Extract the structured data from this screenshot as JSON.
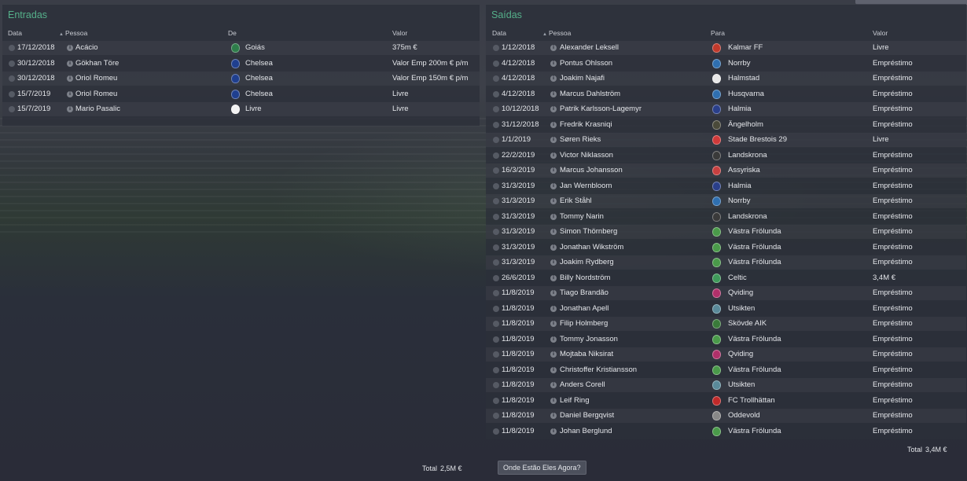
{
  "incoming": {
    "title": "Entradas",
    "headers": {
      "date": "Data",
      "person": "Pessoa",
      "from": "De",
      "value": "Valor"
    },
    "rows": [
      {
        "date": "17/12/2018",
        "person": "Acácio",
        "club": "Goiás",
        "value": "375m €",
        "badge_color": "#2e7d4a"
      },
      {
        "date": "30/12/2018",
        "person": "Gökhan Töre",
        "club": "Chelsea",
        "value": "Valor Emp 200m € p/m",
        "badge_color": "#1f3f8f"
      },
      {
        "date": "30/12/2018",
        "person": "Oriol Romeu",
        "club": "Chelsea",
        "value": "Valor Emp 150m € p/m",
        "badge_color": "#1f3f8f"
      },
      {
        "date": "15/7/2019",
        "person": "Oriol Romeu",
        "club": "Chelsea",
        "value": "Livre",
        "badge_color": "#1f3f8f"
      },
      {
        "date": "15/7/2019",
        "person": "Mario Pasalic",
        "club": "Livre",
        "value": "Livre",
        "badge_color": "#f2f2f2"
      }
    ],
    "total_label": "Total",
    "total_value": "2,5M €"
  },
  "outgoing": {
    "title": "Saídas",
    "headers": {
      "date": "Data",
      "person": "Pessoa",
      "to": "Para",
      "value": "Valor"
    },
    "rows": [
      {
        "date": "1/12/2018",
        "person": "Alexander Leksell",
        "club": "Kalmar FF",
        "value": "Livre",
        "badge_color": "#c0392b"
      },
      {
        "date": "4/12/2018",
        "person": "Pontus Ohlsson",
        "club": "Norrby",
        "value": "Empréstimo",
        "badge_color": "#2f6fb0"
      },
      {
        "date": "4/12/2018",
        "person": "Joakim Najafi",
        "club": "Halmstad",
        "value": "Empréstimo",
        "badge_color": "#e8e8e8"
      },
      {
        "date": "4/12/2018",
        "person": "Marcus Dahlström",
        "club": "Husqvarna",
        "value": "Empréstimo",
        "badge_color": "#2f6fb0"
      },
      {
        "date": "10/12/2018",
        "person": "Patrik Karlsson-Lagemyr",
        "club": "Halmia",
        "value": "Empréstimo",
        "badge_color": "#2a3f8a"
      },
      {
        "date": "31/12/2018",
        "person": "Fredrik Krasniqi",
        "club": "Ängelholm",
        "value": "Empréstimo",
        "badge_color": "#4a4a3a"
      },
      {
        "date": "1/1/2019",
        "person": "Søren Rieks",
        "club": "Stade Brestois 29",
        "value": "Livre",
        "badge_color": "#d03a3a"
      },
      {
        "date": "22/2/2019",
        "person": "Victor Niklasson",
        "club": "Landskrona",
        "value": "Empréstimo",
        "badge_color": "#3a3a3a"
      },
      {
        "date": "16/3/2019",
        "person": "Marcus Johansson",
        "club": "Assyriska",
        "value": "Empréstimo",
        "badge_color": "#c74040"
      },
      {
        "date": "31/3/2019",
        "person": "Jan Wernbloom",
        "club": "Halmia",
        "value": "Empréstimo",
        "badge_color": "#2a3f8a"
      },
      {
        "date": "31/3/2019",
        "person": "Erik Ståhl",
        "club": "Norrby",
        "value": "Empréstimo",
        "badge_color": "#2f6fb0"
      },
      {
        "date": "31/3/2019",
        "person": "Tommy Narin",
        "club": "Landskrona",
        "value": "Empréstimo",
        "badge_color": "#3a3a3a"
      },
      {
        "date": "31/3/2019",
        "person": "Simon Thörnberg",
        "club": "Västra Frölunda",
        "value": "Empréstimo",
        "badge_color": "#4a9a4a"
      },
      {
        "date": "31/3/2019",
        "person": "Jonathan Wikström",
        "club": "Västra Frölunda",
        "value": "Empréstimo",
        "badge_color": "#4a9a4a"
      },
      {
        "date": "31/3/2019",
        "person": "Joakim Rydberg",
        "club": "Västra Frölunda",
        "value": "Empréstimo",
        "badge_color": "#4a9a4a"
      },
      {
        "date": "26/6/2019",
        "person": "Billy Nordström",
        "club": "Celtic",
        "value": "3,4M €",
        "badge_color": "#3f9a5a"
      },
      {
        "date": "11/8/2019",
        "person": "Tiago Brandão",
        "club": "Qviding",
        "value": "Empréstimo",
        "badge_color": "#b0306a"
      },
      {
        "date": "11/8/2019",
        "person": "Jonathan Apell",
        "club": "Utsikten",
        "value": "Empréstimo",
        "badge_color": "#5a8a9a"
      },
      {
        "date": "11/8/2019",
        "person": "Filip Holmberg",
        "club": "Skövde AIK",
        "value": "Empréstimo",
        "badge_color": "#3a7a3a"
      },
      {
        "date": "11/8/2019",
        "person": "Tommy Jonasson",
        "club": "Västra Frölunda",
        "value": "Empréstimo",
        "badge_color": "#4a9a4a"
      },
      {
        "date": "11/8/2019",
        "person": "Mojtaba Niksirat",
        "club": "Qviding",
        "value": "Empréstimo",
        "badge_color": "#b0306a"
      },
      {
        "date": "11/8/2019",
        "person": "Christoffer Kristiansson",
        "club": "Västra Frölunda",
        "value": "Empréstimo",
        "badge_color": "#4a9a4a"
      },
      {
        "date": "11/8/2019",
        "person": "Anders Corell",
        "club": "Utsikten",
        "value": "Empréstimo",
        "badge_color": "#5a8a9a"
      },
      {
        "date": "11/8/2019",
        "person": "Leif Ring",
        "club": "FC Trollhättan",
        "value": "Empréstimo",
        "badge_color": "#c02a2a"
      },
      {
        "date": "11/8/2019",
        "person": "Daniel Bergqvist",
        "club": "Oddevold",
        "value": "Empréstimo",
        "badge_color": "#888888"
      },
      {
        "date": "11/8/2019",
        "person": "Johan Berglund",
        "club": "Västra Frölunda",
        "value": "Empréstimo",
        "badge_color": "#4a9a4a"
      }
    ],
    "total_label": "Total",
    "total_value": "3,4M €"
  },
  "where_button": "Onde Estão Eles Agora?",
  "colors": {
    "accent_title": "#55b08a",
    "panel": "#2c2f3a"
  }
}
